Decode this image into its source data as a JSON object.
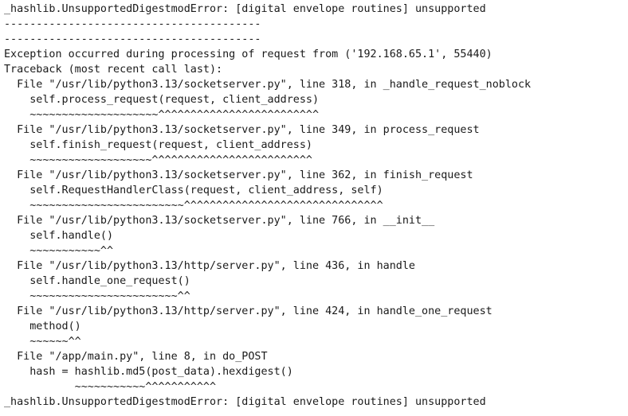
{
  "terminal": {
    "lines": [
      "_hashlib.UnsupportedDigestmodError: [digital envelope routines] unsupported",
      "----------------------------------------",
      "----------------------------------------",
      "Exception occurred during processing of request from ('192.168.65.1', 55440)",
      "Traceback (most recent call last):",
      "  File \"/usr/lib/python3.13/socketserver.py\", line 318, in _handle_request_noblock",
      "    self.process_request(request, client_address)",
      "    ~~~~~~~~~~~~~~~~~~~~^^^^^^^^^^^^^^^^^^^^^^^^^",
      "  File \"/usr/lib/python3.13/socketserver.py\", line 349, in process_request",
      "    self.finish_request(request, client_address)",
      "    ~~~~~~~~~~~~~~~~~~~^^^^^^^^^^^^^^^^^^^^^^^^^",
      "  File \"/usr/lib/python3.13/socketserver.py\", line 362, in finish_request",
      "    self.RequestHandlerClass(request, client_address, self)",
      "    ~~~~~~~~~~~~~~~~~~~~~~~~^^^^^^^^^^^^^^^^^^^^^^^^^^^^^^^",
      "  File \"/usr/lib/python3.13/socketserver.py\", line 766, in __init__",
      "    self.handle()",
      "    ~~~~~~~~~~~^^",
      "  File \"/usr/lib/python3.13/http/server.py\", line 436, in handle",
      "    self.handle_one_request()",
      "    ~~~~~~~~~~~~~~~~~~~~~~~^^",
      "  File \"/usr/lib/python3.13/http/server.py\", line 424, in handle_one_request",
      "    method()",
      "    ~~~~~~^^",
      "  File \"/app/main.py\", line 8, in do_POST",
      "    hash = hashlib.md5(post_data).hexdigest()",
      "           ~~~~~~~~~~~^^^^^^^^^^^",
      "_hashlib.UnsupportedDigestmodError: [digital envelope routines] unsupported"
    ]
  }
}
